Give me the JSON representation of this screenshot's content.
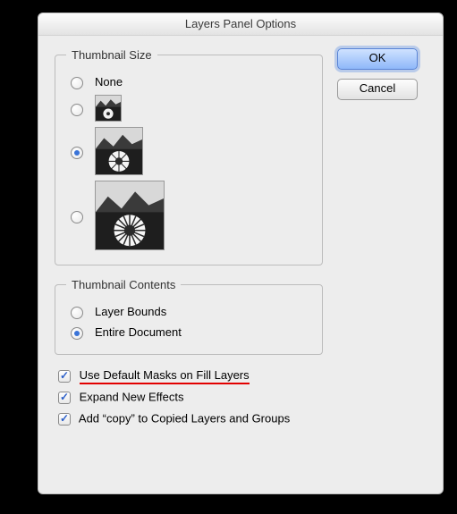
{
  "dialog": {
    "title": "Layers Panel Options"
  },
  "buttons": {
    "ok": "OK",
    "cancel": "Cancel"
  },
  "thumbnail_size": {
    "legend": "Thumbnail Size",
    "none_label": "None",
    "selected": "medium"
  },
  "thumbnail_contents": {
    "legend": "Thumbnail Contents",
    "layer_bounds": "Layer Bounds",
    "entire_document": "Entire Document",
    "selected": "entire_document"
  },
  "checks": {
    "use_default_masks": {
      "label": "Use Default Masks on Fill Layers",
      "checked": true,
      "highlight": true
    },
    "expand_new_effects": {
      "label": "Expand New Effects",
      "checked": true
    },
    "add_copy": {
      "label": "Add “copy” to Copied Layers and Groups",
      "checked": true
    }
  }
}
